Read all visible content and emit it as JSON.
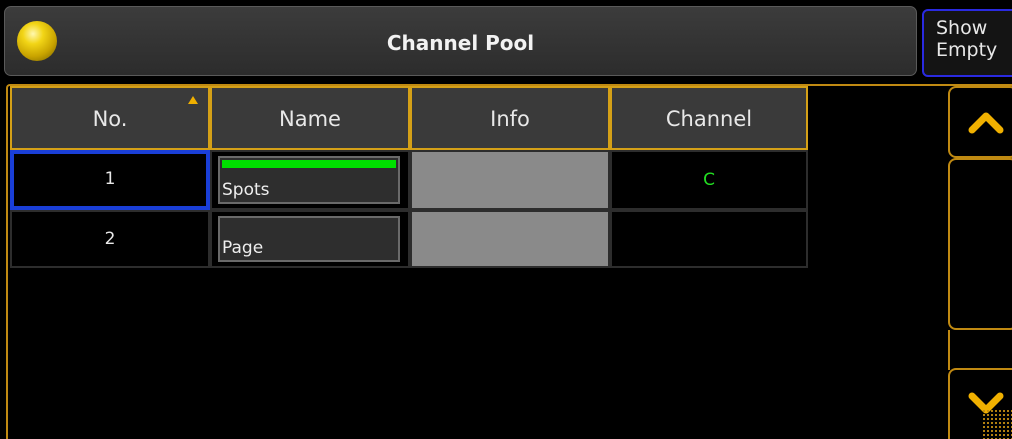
{
  "window": {
    "title": "Channel Pool",
    "show_empty_line1": "Show",
    "show_empty_line2": "Empty"
  },
  "table": {
    "columns": [
      "No.",
      "Name",
      "Info",
      "Channel"
    ],
    "rows": [
      {
        "no": "1",
        "name": "Spots",
        "info": "",
        "channel": "C",
        "color_bar": "#00e000",
        "selected": true
      },
      {
        "no": "2",
        "name": "Page",
        "info": "",
        "channel": "",
        "selected": false
      }
    ]
  },
  "colors": {
    "accent": "#d4a017",
    "selection": "#1a3fd8",
    "channel_text": "#22dd22"
  },
  "icons": {
    "title_icon": "yellow-ball-icon",
    "scroll_up": "chevron-up-icon",
    "scroll_down": "chevron-down-icon"
  }
}
